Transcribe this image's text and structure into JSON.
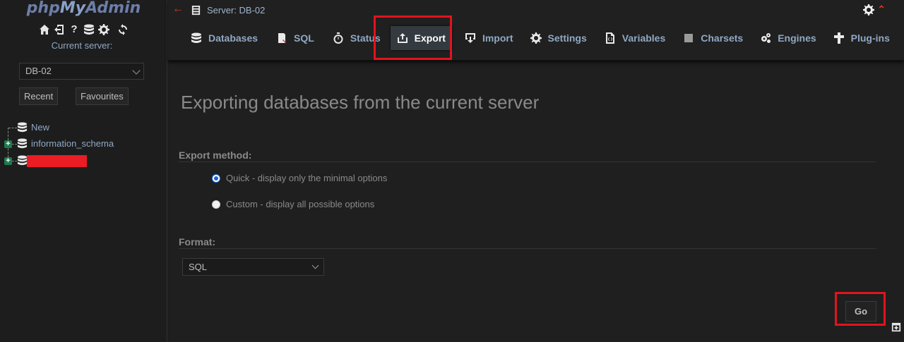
{
  "sidebar": {
    "logo": {
      "php": "php",
      "my": "My",
      "admin": "Admin"
    },
    "nav_icons": [
      "home-icon",
      "logout-icon",
      "help-icon",
      "database-icon",
      "settings-icon",
      "reload-icon"
    ],
    "current_server_label": "Current server:",
    "server_select_value": "DB-02",
    "recent_label": "Recent",
    "favourites_label": "Favourites",
    "tree": [
      {
        "label": "New",
        "expandable": false
      },
      {
        "label": "information_schema",
        "expandable": true
      },
      {
        "label": "",
        "expandable": true,
        "redacted": true
      }
    ]
  },
  "header": {
    "breadcrumb": "Server: DB-02",
    "tabs": [
      {
        "label": "Databases",
        "icon": "database-icon"
      },
      {
        "label": "SQL",
        "icon": "sql-icon"
      },
      {
        "label": "Status",
        "icon": "status-icon"
      },
      {
        "label": "Export",
        "icon": "export-icon",
        "active": true
      },
      {
        "label": "Import",
        "icon": "import-icon"
      },
      {
        "label": "Settings",
        "icon": "gear-icon"
      },
      {
        "label": "Variables",
        "icon": "variables-icon"
      },
      {
        "label": "Charsets",
        "icon": "charsets-icon"
      },
      {
        "label": "Engines",
        "icon": "engines-icon"
      },
      {
        "label": "Plug-ins",
        "icon": "plugin-icon"
      }
    ]
  },
  "main": {
    "title": "Exporting databases from the current server",
    "export_method_label": "Export method:",
    "options": [
      {
        "label": "Quick - display only the minimal options",
        "checked": true
      },
      {
        "label": "Custom - display all possible options",
        "checked": false
      }
    ],
    "format_label": "Format:",
    "format_value": "SQL",
    "go_label": "Go"
  },
  "colors": {
    "highlight": "#e0141e",
    "link": "#8fa8c4",
    "background": "#1f1f1f"
  }
}
